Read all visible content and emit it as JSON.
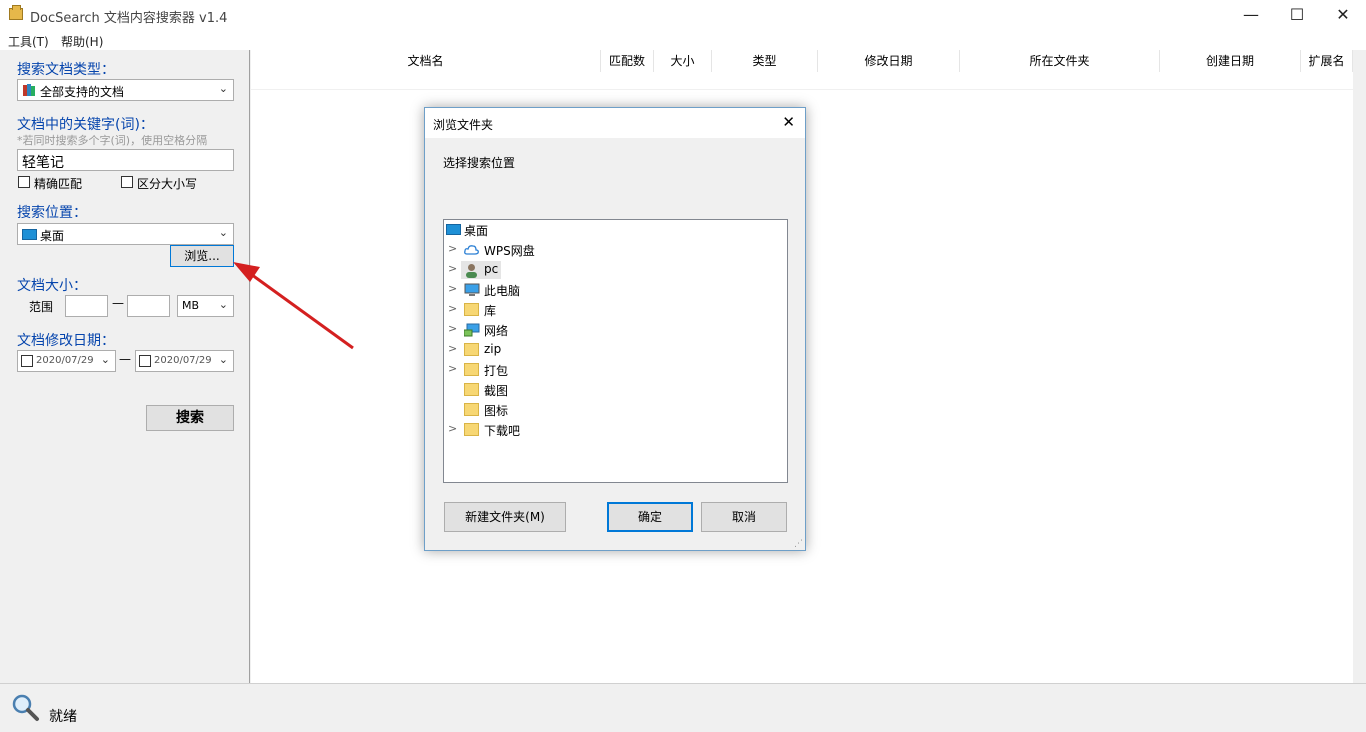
{
  "window": {
    "title": "DocSearch 文档内容搜索器 v1.4",
    "minimize": "—",
    "maximize": "☐",
    "close": "✕"
  },
  "menu": {
    "tools": "工具(T)",
    "help": "帮助(H)"
  },
  "search_panel": {
    "doc_type_label": "搜索文档类型：",
    "doc_type_value": "全部支持的文档",
    "keyword_label": "文档中的关键字(词)：",
    "keyword_hint": "*若同时搜索多个字(词)，使用空格分隔",
    "keyword_value": "轻笔记",
    "exact_match": "精确匹配",
    "case_sensitive": "区分大小写",
    "location_label": "搜索位置：",
    "location_value": "桌面",
    "browse_button": "浏览...",
    "size_label": "文档大小：",
    "range_label": "范围",
    "range_dash": "—",
    "size_unit": "MB",
    "date_label": "文档修改日期：",
    "date_from": "2020/07/29",
    "date_to": "2020/07/29",
    "date_dash": "—",
    "search_button": "搜索"
  },
  "results_table": {
    "columns": [
      "文档名",
      "匹配数",
      "大小",
      "类型",
      "修改日期",
      "所在文件夹",
      "创建日期",
      "扩展名"
    ]
  },
  "status": {
    "text": "就绪"
  },
  "dialog": {
    "title": "浏览文件夹",
    "close": "✕",
    "prompt": "选择搜索位置",
    "tree": [
      {
        "label": "桌面",
        "icon": "desktop-icon",
        "expander": ""
      },
      {
        "label": "WPS网盘",
        "icon": "cloud-icon",
        "expander": ">"
      },
      {
        "label": "pc",
        "icon": "user-icon",
        "expander": ">"
      },
      {
        "label": "此电脑",
        "icon": "computer-icon",
        "expander": ">"
      },
      {
        "label": "库",
        "icon": "library-icon",
        "expander": ">"
      },
      {
        "label": "网络",
        "icon": "network-icon",
        "expander": ">"
      },
      {
        "label": "zip",
        "icon": "folder-icon",
        "expander": ">"
      },
      {
        "label": "打包",
        "icon": "folder-icon",
        "expander": ">"
      },
      {
        "label": "截图",
        "icon": "folder-icon",
        "expander": ""
      },
      {
        "label": "图标",
        "icon": "folder-icon",
        "expander": ""
      },
      {
        "label": "下载吧",
        "icon": "folder-icon",
        "expander": ">"
      }
    ],
    "new_folder_button": "新建文件夹(M)",
    "ok_button": "确定",
    "cancel_button": "取消"
  },
  "colors": {
    "label_blue": "#0645ad",
    "arrow_red": "#d42020",
    "dialog_border": "#6e9fc8",
    "selected_row": "#e5e5e5"
  }
}
